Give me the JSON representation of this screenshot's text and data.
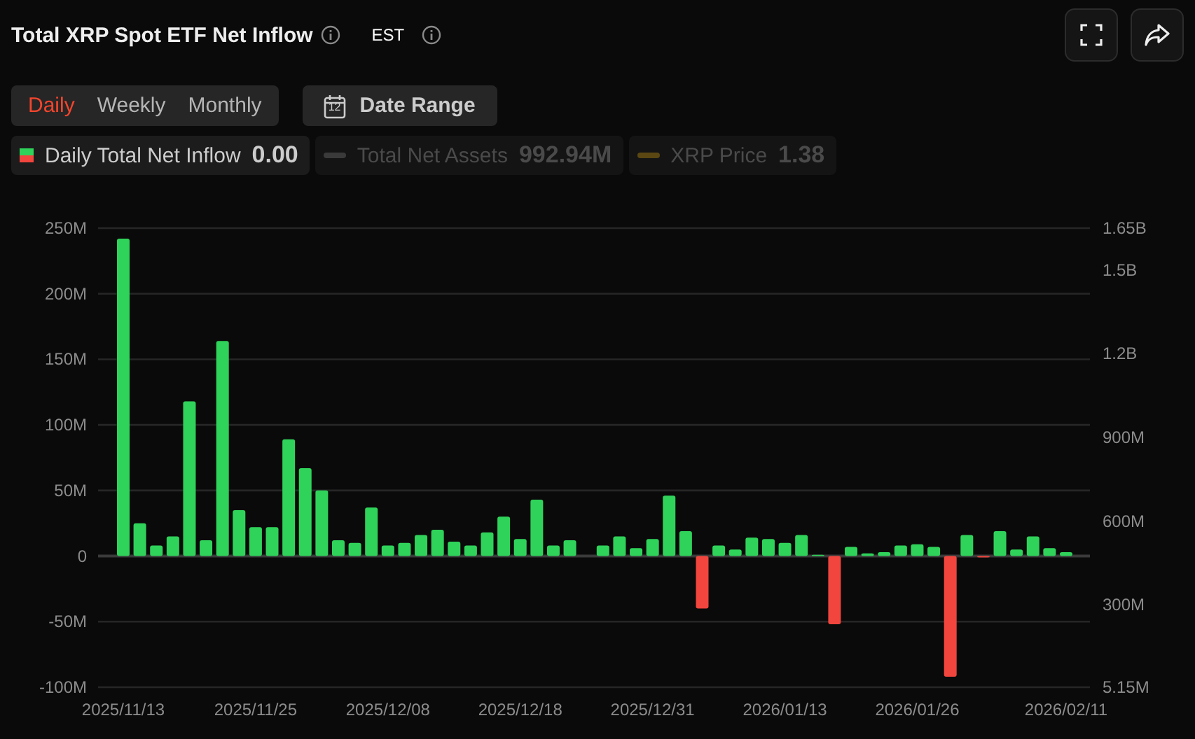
{
  "header": {
    "title": "Total XRP Spot ETF Net Inflow",
    "timezone": "EST"
  },
  "periods": [
    {
      "label": "Daily",
      "selected": true
    },
    {
      "label": "Weekly",
      "selected": false
    },
    {
      "label": "Monthly",
      "selected": false
    }
  ],
  "date_range": {
    "label": "Date Range",
    "calendar_day": "12"
  },
  "legend": [
    {
      "kind": "bars",
      "label": "Daily Total Net Inflow",
      "value": "0.00",
      "enabled": true
    },
    {
      "kind": "line",
      "label": "Total Net Assets",
      "value": "992.94M",
      "enabled": false,
      "color": "#3a3a3a"
    },
    {
      "kind": "line",
      "label": "XRP Price",
      "value": "1.38",
      "enabled": false,
      "color": "#5a4712"
    }
  ],
  "chart_data": {
    "type": "bar",
    "grid": true,
    "categories": [
      "2025/11/13",
      null,
      null,
      null,
      null,
      null,
      null,
      null,
      "2025/11/25",
      null,
      null,
      null,
      null,
      null,
      null,
      null,
      "2025/12/08",
      null,
      null,
      null,
      null,
      null,
      null,
      null,
      "2025/12/18",
      null,
      null,
      null,
      null,
      null,
      null,
      null,
      "2025/12/31",
      null,
      null,
      null,
      null,
      null,
      null,
      null,
      "2026/01/13",
      null,
      null,
      null,
      null,
      null,
      null,
      null,
      "2026/01/26",
      null,
      null,
      null,
      null,
      null,
      null,
      null,
      null,
      "2026/02/11"
    ],
    "stacked": true,
    "series": [
      {
        "color": "#2fd35a",
        "values": [
          242,
          25,
          8,
          15,
          118,
          12,
          164,
          35,
          22,
          22,
          89,
          67,
          50,
          12,
          10,
          37,
          8,
          10,
          16,
          20,
          11,
          8,
          18,
          30,
          13,
          43,
          8,
          12,
          null,
          8,
          15,
          6,
          13,
          46,
          19,
          null,
          8,
          5,
          14,
          13,
          10,
          16,
          1,
          null,
          7,
          2,
          3,
          8,
          9,
          7,
          null,
          16,
          null,
          19,
          5,
          15,
          6,
          3
        ]
      },
      {
        "color": "#f2453d",
        "values": [
          null,
          null,
          null,
          null,
          null,
          null,
          null,
          null,
          null,
          null,
          null,
          null,
          null,
          null,
          null,
          null,
          null,
          null,
          null,
          null,
          null,
          null,
          null,
          null,
          null,
          null,
          null,
          null,
          null,
          null,
          null,
          null,
          null,
          null,
          null,
          -40,
          null,
          null,
          null,
          null,
          null,
          null,
          null,
          -52,
          null,
          null,
          null,
          null,
          null,
          null,
          -92,
          null,
          -1,
          null,
          null,
          null,
          null,
          null
        ]
      }
    ],
    "ylim": [
      -100,
      250
    ],
    "yticks": [
      {
        "value": 250,
        "label": "250M"
      },
      {
        "value": 200,
        "label": "200M"
      },
      {
        "value": 150,
        "label": "150M"
      },
      {
        "value": 100,
        "label": "100M"
      },
      {
        "value": 50,
        "label": "50M"
      },
      {
        "value": 0,
        "label": "0"
      },
      {
        "value": -50,
        "label": "-50M"
      },
      {
        "value": -100,
        "label": "-100M"
      }
    ],
    "y2lim": [
      5150000,
      1650000000
    ],
    "y2ticks": [
      {
        "value": 1650000000,
        "label": "1.65B"
      },
      {
        "value": 1500000000,
        "label": "1.5B"
      },
      {
        "value": 1200000000,
        "label": "1.2B"
      },
      {
        "value": 900000000,
        "label": "900M"
      },
      {
        "value": 600000000,
        "label": "600M"
      },
      {
        "value": 300000000,
        "label": "300M"
      },
      {
        "value": 5150000,
        "label": "5.15M"
      }
    ]
  }
}
